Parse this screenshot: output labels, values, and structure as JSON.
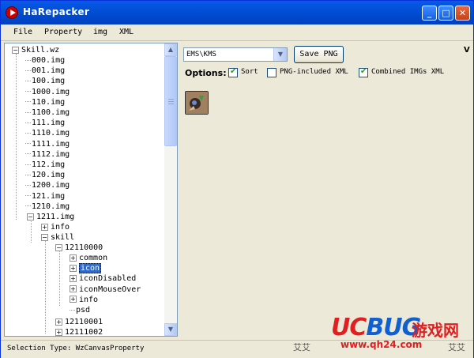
{
  "window": {
    "title": "HaRepacker",
    "minimize": "_",
    "maximize": "□",
    "close": "✕"
  },
  "menu": {
    "file": "File",
    "property": "Property",
    "img": "img",
    "xml": "XML"
  },
  "tree": {
    "root": "Skill.wz",
    "imgs": [
      "000.img",
      "001.img",
      "100.img",
      "1000.img",
      "110.img",
      "1100.img",
      "111.img",
      "1110.img",
      "1111.img",
      "1112.img",
      "112.img",
      "120.img",
      "1200.img",
      "121.img",
      "1210.img"
    ],
    "expanded_img": "1211.img",
    "child_info": "info",
    "child_skill": "skill",
    "skill_id": "12110000",
    "skill_children": [
      "common",
      "icon",
      "iconDisabled",
      "iconMouseOver",
      "info",
      "psd"
    ],
    "selected": "icon",
    "more_skills": [
      "12110001",
      "12111002"
    ]
  },
  "toolbar": {
    "region_select": "EMS\\KMS",
    "save_png": "Save PNG",
    "options_label": "Options:",
    "sort_label": "Sort",
    "sort_checked": true,
    "png_xml_label": "PNG-included XML",
    "png_xml_checked": false,
    "combined_label": "Combined IMGs XML",
    "combined_checked": true,
    "v_label": "V"
  },
  "status": {
    "text": "Selection Type: WzCanvasProperty"
  },
  "watermark": {
    "logo_uc": "UC",
    "logo_bug": "BUG",
    "logo_cn": "游戏网",
    "url": "www.qh24.com",
    "faint_left": "艾艾",
    "faint_right": "艾艾"
  }
}
